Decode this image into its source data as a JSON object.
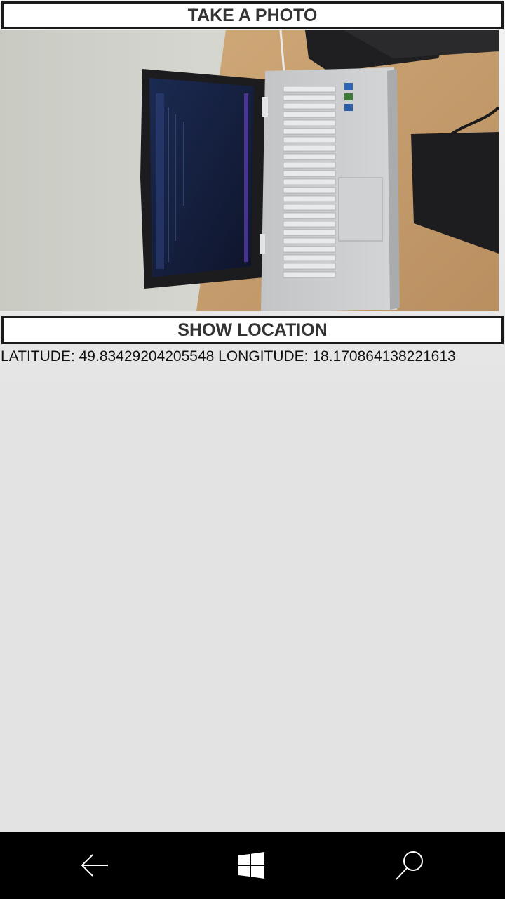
{
  "actions": {
    "take_photo_label": "TAKE A PHOTO",
    "show_location_label": "SHOW LOCATION"
  },
  "location": {
    "text": "LATITUDE: 49.83429204205548 LONGITUDE: 18.170864138221613"
  },
  "photo": {
    "description_name": "captured-photo"
  },
  "nav": {
    "back_icon": "back-arrow-icon",
    "start_icon": "windows-logo-icon",
    "search_icon": "search-icon"
  },
  "colors": {
    "button_border": "#1a1a1a",
    "button_text": "#333333",
    "nav_background": "#000000",
    "page_background": "#e3e3e3"
  }
}
